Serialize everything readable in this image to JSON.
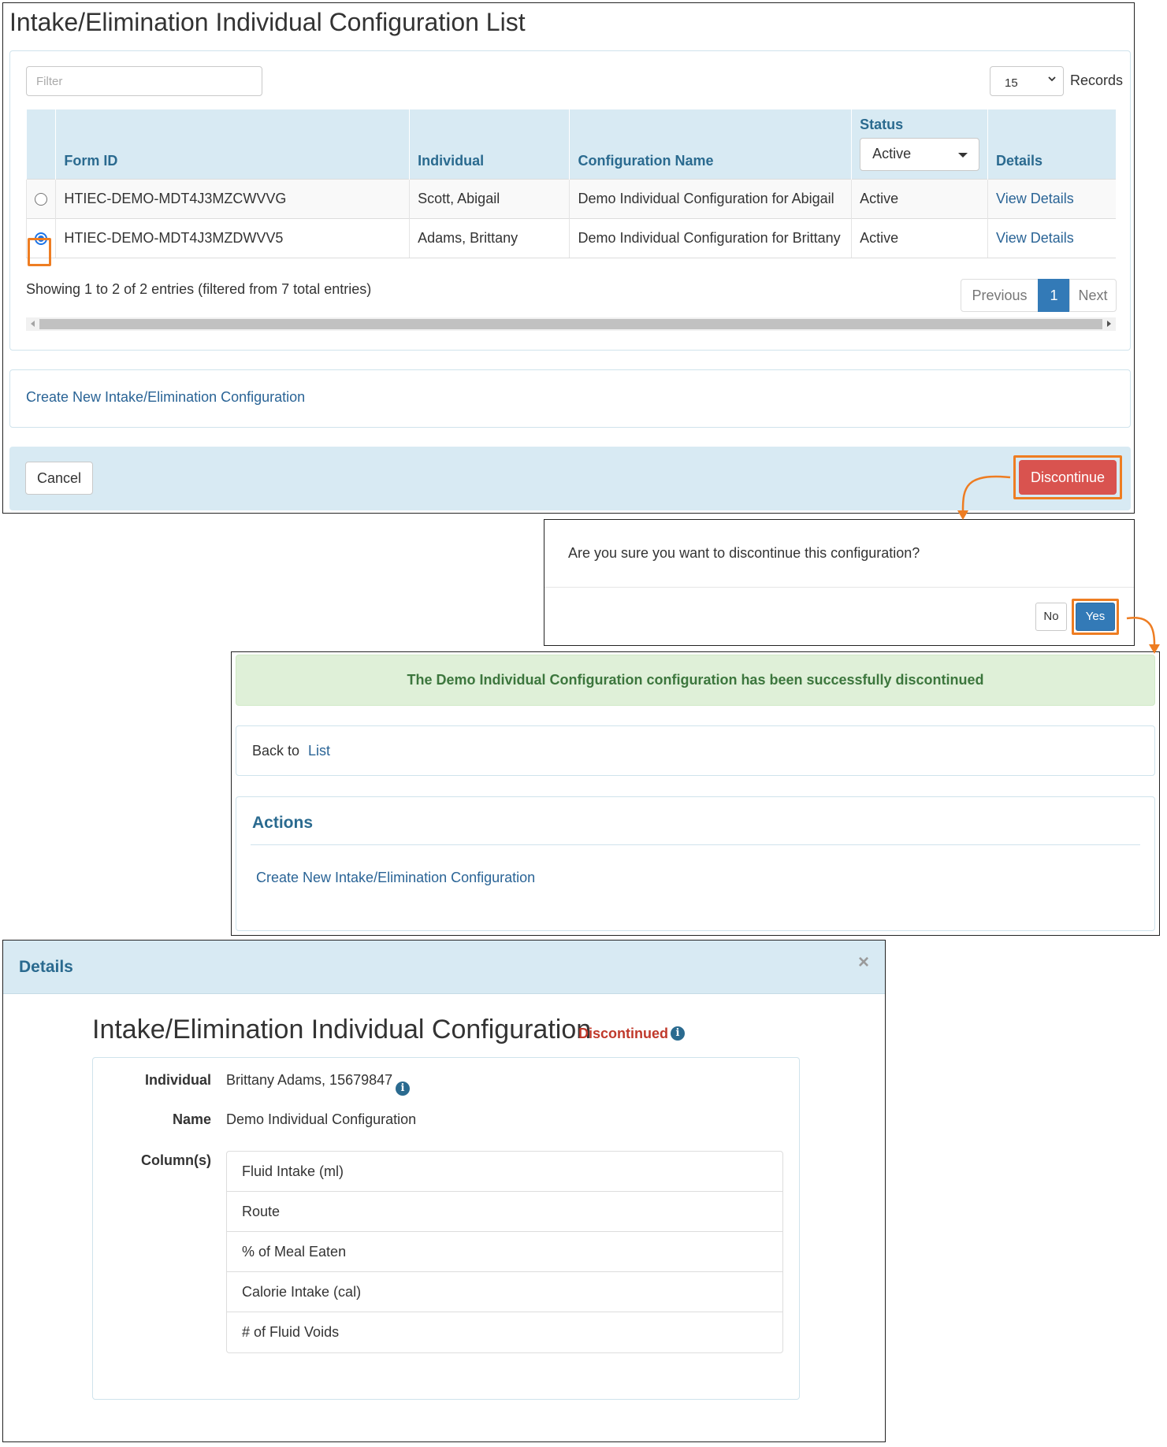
{
  "list_screen": {
    "title": "Intake/Elimination Individual Configuration List",
    "filter_placeholder": "Filter",
    "records_value": "15",
    "records_label": "Records",
    "columns": {
      "form_id": "Form ID",
      "individual": "Individual",
      "config_name": "Configuration Name",
      "status": "Status",
      "details": "Details"
    },
    "status_filter_value": "Active",
    "rows": [
      {
        "form_id": "HTIEC-DEMO-MDT4J3MZCWVVG",
        "individual": "Scott, Abigail",
        "config_name": "Demo Individual Configuration for Abigail",
        "status": "Active",
        "details_link": "View Details",
        "selected": false
      },
      {
        "form_id": "HTIEC-DEMO-MDT4J3MZDWVV5",
        "individual": "Adams, Brittany",
        "config_name": "Demo Individual Configuration for Brittany",
        "status": "Active",
        "details_link": "View Details",
        "selected": true
      }
    ],
    "showing_text": "Showing 1 to 2 of 2 entries (filtered from 7 total entries)",
    "pagination": {
      "previous": "Previous",
      "current": "1",
      "next": "Next"
    },
    "create_link": "Create New Intake/Elimination Configuration",
    "cancel_label": "Cancel",
    "discontinue_label": "Discontinue"
  },
  "confirm_dialog": {
    "message": "Are you sure you want to discontinue this configuration?",
    "no_label": "No",
    "yes_label": "Yes"
  },
  "success_screen": {
    "message": "The Demo Individual Configuration configuration has been successfully discontinued",
    "back_text": "Back to",
    "back_link": "List",
    "actions_heading": "Actions",
    "create_link": "Create New Intake/Elimination Configuration"
  },
  "details_modal": {
    "header": "Details",
    "close_glyph": "×",
    "title": "Intake/Elimination Individual Configuration",
    "status": "Discontinued",
    "individual_label": "Individual",
    "individual_value": "Brittany Adams, 15679847",
    "name_label": "Name",
    "name_value": "Demo Individual Configuration",
    "columns_label": "Column(s)",
    "columns": [
      "Fluid Intake (ml)",
      "Route",
      "% of Meal Eaten",
      "Calorie Intake (cal)",
      "# of Fluid Voids"
    ]
  },
  "colors": {
    "header_blue": "#d8eaf3",
    "heading_text": "#2a6a8f",
    "link": "#2a6496",
    "primary": "#337ab7",
    "danger": "#d9534f",
    "success_bg": "#dff0d8",
    "success_text": "#3c763d",
    "highlight": "#ee7d22",
    "discontinued": "#c0392b"
  },
  "icons": [
    "info-icon",
    "close-icon",
    "chevron-down-icon",
    "caret-down-icon",
    "radio-button"
  ]
}
